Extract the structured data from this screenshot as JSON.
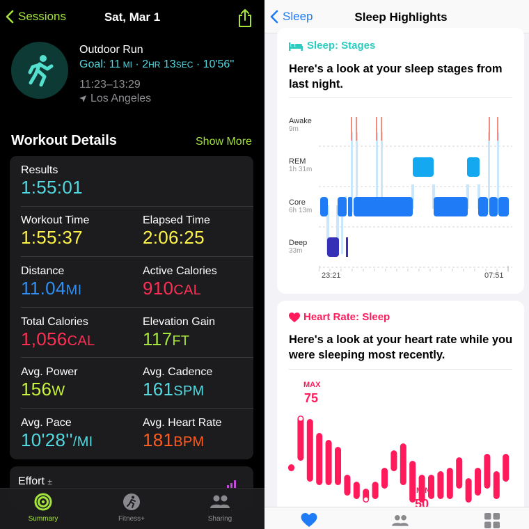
{
  "left": {
    "nav": {
      "back_label": "Sessions",
      "date": "Sat, Mar 1"
    },
    "workout": {
      "name": "Outdoor Run",
      "goal_prefix": "Goal: 11",
      "goal_unit1": "MI",
      "goal_mid": " · 2",
      "goal_unit2": "HR",
      "goal_mid2": " 13",
      "goal_unit3": "SEC",
      "goal_suffix": " · 10'56''",
      "time_range": "11:23–13:29",
      "location": "Los Angeles"
    },
    "section": {
      "title": "Workout Details",
      "show_more": "Show More"
    },
    "metrics": {
      "results": {
        "label": "Results",
        "value": "1:55:01"
      },
      "workout_time": {
        "label": "Workout Time",
        "value": "1:55:37"
      },
      "elapsed_time": {
        "label": "Elapsed Time",
        "value": "2:06:25"
      },
      "distance": {
        "label": "Distance",
        "value": "11.04",
        "unit": "MI"
      },
      "active_calories": {
        "label": "Active Calories",
        "value": "910",
        "unit": "CAL"
      },
      "total_calories": {
        "label": "Total Calories",
        "value": "1,056",
        "unit": "CAL"
      },
      "elevation_gain": {
        "label": "Elevation Gain",
        "value": "117",
        "unit": "FT"
      },
      "avg_power": {
        "label": "Avg. Power",
        "value": "156",
        "unit": "W"
      },
      "avg_cadence": {
        "label": "Avg. Cadence",
        "value": "161",
        "unit": "SPM"
      },
      "avg_pace": {
        "label": "Avg. Pace",
        "value": "10'28''",
        "unit": "/MI"
      },
      "avg_heart_rate": {
        "label": "Avg. Heart Rate",
        "value": "181",
        "unit": "BPM"
      }
    },
    "effort": {
      "label": "Effort",
      "suffix": "±"
    },
    "tabbar": {
      "summary": "Summary",
      "fitness": "Fitness+",
      "sharing": "Sharing"
    }
  },
  "right": {
    "nav": {
      "back_label": "Sleep",
      "title": "Sleep Highlights"
    },
    "sleep_card": {
      "heading": "Sleep: Stages",
      "body": "Here's a look at your sleep stages from last night.",
      "stages": [
        {
          "name": "Awake",
          "duration": "9m"
        },
        {
          "name": "REM",
          "duration": "1h 31m"
        },
        {
          "name": "Core",
          "duration": "6h 13m"
        },
        {
          "name": "Deep",
          "duration": "33m"
        }
      ],
      "time_start": "23:21",
      "time_end": "07:51"
    },
    "heart_card": {
      "heading": "Heart Rate: Sleep",
      "body": "Here's a look at your heart rate while you were sleeping most recently.",
      "max_label": "MAX",
      "max_value": "75",
      "min_label": "MIN",
      "min_value": "50"
    }
  },
  "chart_data": [
    {
      "type": "bar",
      "title": "Sleep: Stages",
      "categories": [
        "Awake",
        "REM",
        "Core",
        "Deep"
      ],
      "series": [
        {
          "values": [
            9,
            91,
            373,
            33
          ]
        }
      ],
      "x": [
        "23:21",
        "07:51"
      ]
    },
    {
      "type": "bar",
      "title": "Heart Rate: Sleep",
      "series": [
        {
          "values": [
            [
              59,
              61
            ],
            [
              62,
              75
            ],
            [
              56,
              74
            ],
            [
              55,
              70
            ],
            [
              55,
              68
            ],
            [
              55,
              66
            ],
            [
              52,
              58
            ],
            [
              51,
              56
            ],
            [
              50,
              54
            ],
            [
              51,
              56
            ],
            [
              54,
              60
            ],
            [
              59,
              65
            ],
            [
              55,
              67
            ],
            [
              50,
              62
            ],
            [
              50,
              58
            ],
            [
              51,
              58
            ],
            [
              51,
              59
            ],
            [
              51,
              60
            ],
            [
              54,
              63
            ],
            [
              50,
              57
            ],
            [
              52,
              60
            ],
            [
              54,
              64
            ],
            [
              51,
              59
            ],
            [
              56,
              64
            ]
          ]
        }
      ],
      "ylim": [
        48,
        78
      ]
    }
  ],
  "colors": {
    "activity_green": "#a4e43c",
    "goal_cyan": "#53d9e0",
    "ios_blue": "#1f7cf6",
    "heart_pink": "#ff1a5c",
    "sleep_teal": "#2ecbc0"
  }
}
